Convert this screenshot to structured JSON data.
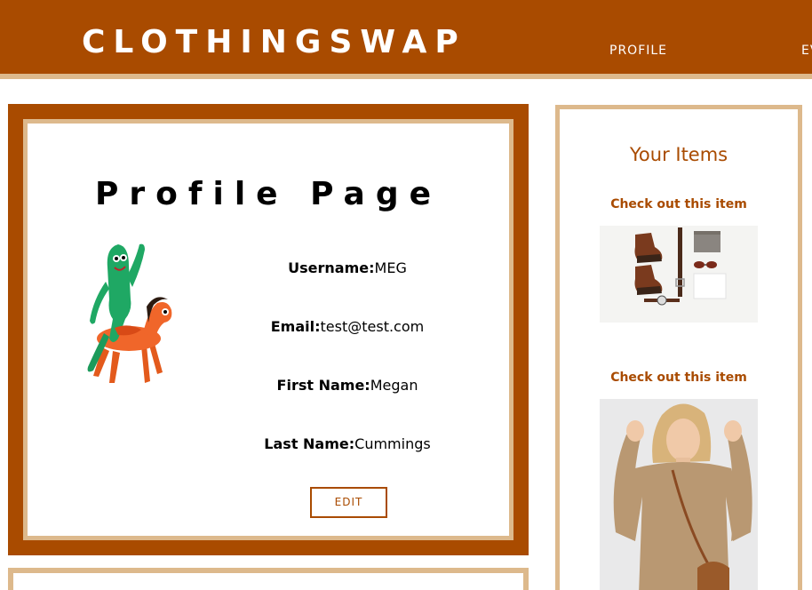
{
  "header": {
    "brand": "CLOTHINGSWAP",
    "nav": {
      "profile": "PROFILE",
      "events": "EV"
    },
    "colors": {
      "primary": "#a94b00",
      "accent": "#ddb98c"
    }
  },
  "profile": {
    "title": "Profile Page",
    "avatar_icon": "gumby-on-pokey-image",
    "fields": {
      "username": {
        "label": "Username:",
        "value": "MEG"
      },
      "email": {
        "label": "Email:",
        "value": "test@test.com"
      },
      "first_name": {
        "label": "First Name:",
        "value": "Megan"
      },
      "last_name": {
        "label": "Last Name:",
        "value": "Cummings"
      }
    },
    "edit_label": "EDIT"
  },
  "items": {
    "title": "Your Items",
    "list": [
      {
        "link": "Check out this item",
        "image": "boots-and-accessories-flatlay-image"
      },
      {
        "link": "Check out this item",
        "image": "woman-in-tan-sweater-image"
      }
    ]
  }
}
